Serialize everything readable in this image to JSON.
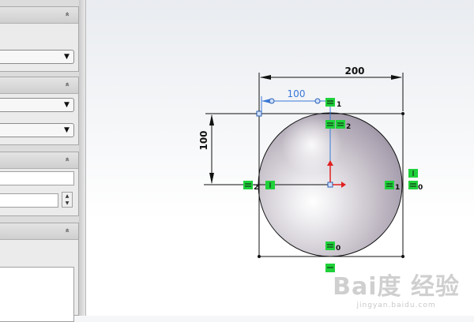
{
  "panel": {
    "collapse_glyph": "»"
  },
  "sketch": {
    "dimensions": {
      "width": "200",
      "height": "100",
      "horizontal_offset": "100"
    },
    "relation_labels": {
      "top_right": "1",
      "top_center": "2",
      "left_mid": "2",
      "right_mid_a": "1",
      "right_mid_b": "0",
      "bottom_center": "0"
    },
    "colors": {
      "relation_green": "#1fd13a",
      "dimension_blue": "#3a78d8",
      "origin_red": "#e02020"
    }
  },
  "watermark": {
    "brand": "Bai度 经验",
    "url": "jingyan.baidu.com"
  }
}
